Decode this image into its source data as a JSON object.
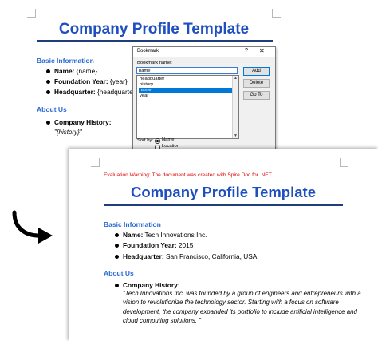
{
  "template_page": {
    "title": "Company Profile Template",
    "basic_info_heading": "Basic Information",
    "items": [
      {
        "label": "Name:",
        "value": " {name}"
      },
      {
        "label": "Foundation Year:",
        "value": " {year}"
      },
      {
        "label": "Headquarter:",
        "value": " {headquarter}"
      }
    ],
    "about_heading": "About Us",
    "history_label": "Company History:",
    "history_value": "\"{history}\""
  },
  "dialog": {
    "title": "Bookmark",
    "help": "?",
    "close": "✕",
    "name_label": "Bookmark name:",
    "name_value": "name",
    "list": [
      "headquarter",
      "history",
      "name",
      "year"
    ],
    "selected_index": 2,
    "buttons": {
      "add": "Add",
      "delete": "Delete",
      "goto": "Go To"
    },
    "sort_label": "Sort by:",
    "sort_options": [
      "Name",
      "Location"
    ],
    "sort_selected": "Name"
  },
  "result_page": {
    "warning": "Evaluation Warning: The document was created with Spire.Doc for .NET.",
    "title": "Company Profile Template",
    "basic_info_heading": "Basic Information",
    "items": [
      {
        "label": "Name:",
        "value": " Tech Innovations Inc."
      },
      {
        "label": "Foundation Year:",
        "value": " 2015"
      },
      {
        "label": "Headquarter:",
        "value": " San Francisco, California, USA"
      }
    ],
    "about_heading": "About Us",
    "history_label": "Company History:",
    "history_value": "\"Tech Innovations Inc. was founded by a group of engineers and entrepreneurs with a vision to revolutionize the technology sector. Starting with a focus on software development, the company expanded its portfolio to include artificial intelligence and cloud computing solutions. \""
  },
  "colors": {
    "title_blue": "#1f4fbf",
    "heading_blue": "#2a6ad2",
    "warning_red": "#e00000",
    "selection": "#0078d7"
  }
}
